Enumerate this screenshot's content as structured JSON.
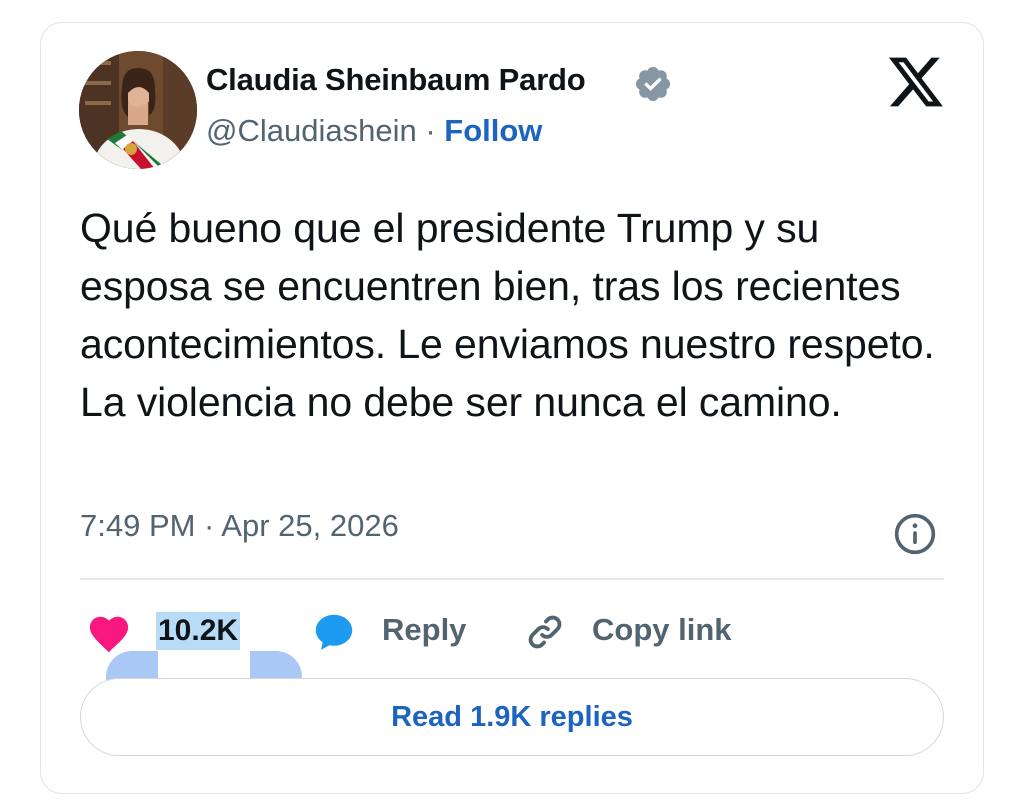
{
  "author": {
    "name": "Claudia Sheinbaum Pardo",
    "handle": "@Claudiashein",
    "separator": " · ",
    "follow_label": "Follow",
    "verified_icon": "verified-badge-icon",
    "avatar_icon": "profile-photo"
  },
  "platform": {
    "logo_icon": "x-logo-icon"
  },
  "tweet": {
    "text": "Qué bueno que el presidente Trump y su esposa se encuentren bien, tras los recientes acontecimientos. Le enviamos nuestro respeto. La violencia no debe ser nunca el camino.",
    "timestamp": "7:49 PM · Apr 25, 2026",
    "info_icon": "info-icon"
  },
  "actions": {
    "like_count": "10.2K",
    "reply_label": "Reply",
    "copy_link_label": "Copy link",
    "read_replies_label": "Read 1.9K replies"
  },
  "colors": {
    "accent": "#1d64c0",
    "heart": "#f91880",
    "reply_icon": "#1d9bf0",
    "text_primary": "#0f1419",
    "text_secondary": "#536471",
    "selection": "#b8dcf7",
    "selection_handle": "#a9c8f5"
  }
}
